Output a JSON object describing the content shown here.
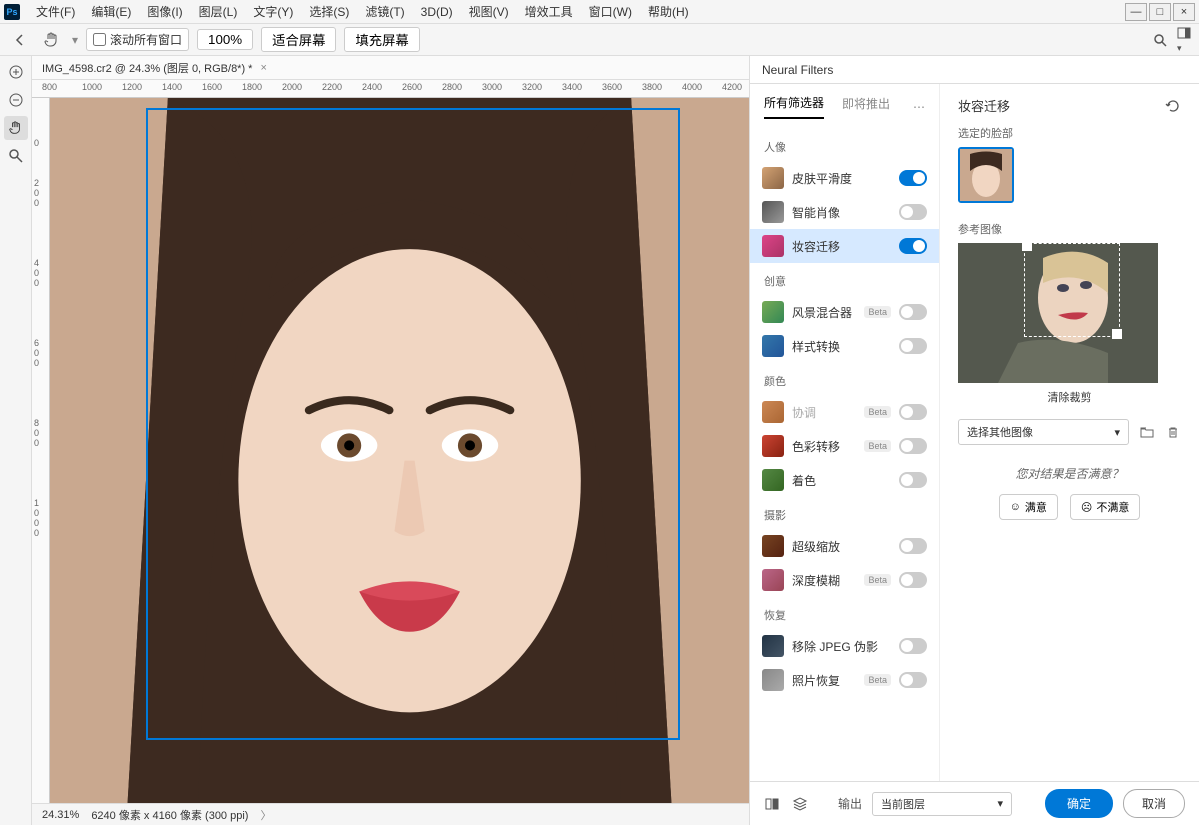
{
  "menubar": {
    "items": [
      {
        "label": "文件(F)"
      },
      {
        "label": "编辑(E)"
      },
      {
        "label": "图像(I)"
      },
      {
        "label": "图层(L)"
      },
      {
        "label": "文字(Y)"
      },
      {
        "label": "选择(S)"
      },
      {
        "label": "滤镜(T)"
      },
      {
        "label": "3D(D)"
      },
      {
        "label": "视图(V)"
      },
      {
        "label": "增效工具"
      },
      {
        "label": "窗口(W)"
      },
      {
        "label": "帮助(H)"
      }
    ]
  },
  "options": {
    "scroll_all": "滚动所有窗口",
    "zoom_value": "100%",
    "fit_screen": "适合屏幕",
    "fill_screen": "填充屏幕"
  },
  "document": {
    "tab_title": "IMG_4598.cr2 @ 24.3% (图层 0, RGB/8*) *"
  },
  "ruler_h": [
    "800",
    "1000",
    "1200",
    "1400",
    "1600",
    "1800",
    "2000",
    "2200",
    "2400",
    "2600",
    "2800",
    "3000",
    "3200",
    "3400",
    "3600",
    "3800",
    "4000",
    "4200"
  ],
  "ruler_v": [
    "0",
    "2",
    "0",
    "0",
    "4",
    "0",
    "0",
    "6",
    "0",
    "0",
    "8",
    "0",
    "0",
    "1",
    "0",
    "0",
    "0"
  ],
  "status": {
    "zoom": "24.31%",
    "dims": "6240 像素 x 4160 像素 (300 ppi)"
  },
  "panel": {
    "tab": "Neural Filters",
    "tabs": {
      "all": "所有筛选器",
      "upcoming": "即将推出"
    },
    "sections": {
      "portrait": "人像",
      "creative": "创意",
      "color": "颜色",
      "photo": "摄影",
      "restore": "恢复"
    },
    "filters": {
      "skin": "皮肤平滑度",
      "smart": "智能肖像",
      "makeup": "妆容迁移",
      "landscape": "风景混合器",
      "style": "样式转换",
      "harmonize": "协调",
      "colortransfer": "色彩转移",
      "colorize": "着色",
      "superzoom": "超级缩放",
      "depthblur": "深度模糊",
      "jpeg": "移除 JPEG 伪影",
      "restore": "照片恢复"
    },
    "beta": "Beta"
  },
  "settings": {
    "title": "妆容迁移",
    "face_label": "选定的脸部",
    "ref_label": "参考图像",
    "clear_crop": "清除裁剪",
    "select_other": "选择其他图像",
    "satisfy": "您对结果是否满意？",
    "happy": "满意",
    "unhappy": "不满意"
  },
  "actions": {
    "output_label": "输出",
    "output_value": "当前图层",
    "ok": "确定",
    "cancel": "取消"
  }
}
